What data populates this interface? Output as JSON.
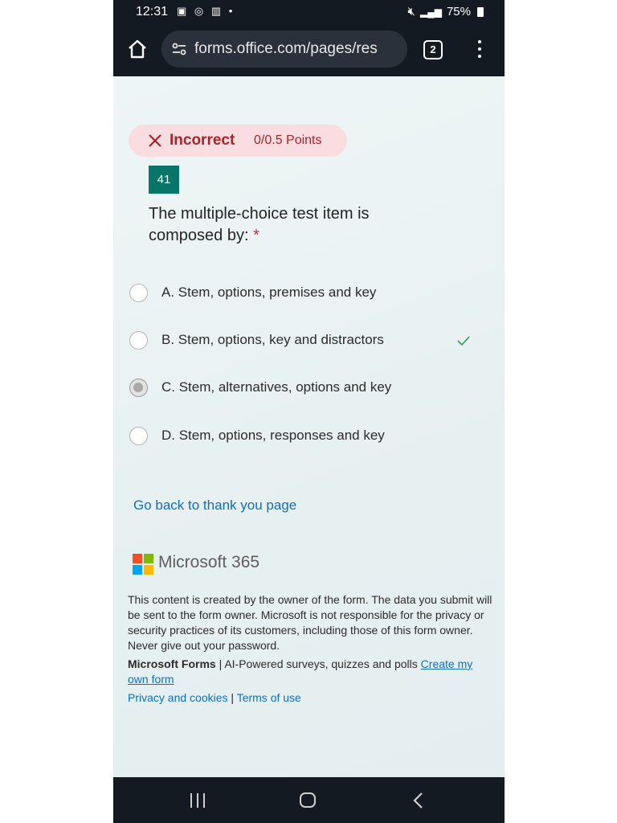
{
  "status_bar": {
    "time": "12:31",
    "left_icons": [
      "gallery-icon",
      "whatsapp-icon",
      "book-icon",
      "dot-icon"
    ],
    "battery": "75%"
  },
  "browser": {
    "url": "forms.office.com/pages/res",
    "tab_count": "2"
  },
  "result": {
    "status": "Incorrect",
    "points": "0/0.5 Points",
    "color": "#a4262c"
  },
  "question": {
    "number": "41",
    "text": "The multiple-choice test item is composed by:",
    "required_mark": "*",
    "options": [
      {
        "label": "A. Stem, options, premises and key",
        "selected": false,
        "correct": false
      },
      {
        "label": "B. Stem, options, key and distractors",
        "selected": false,
        "correct": true
      },
      {
        "label": "C. Stem, alternatives, options and key",
        "selected": true,
        "correct": false
      },
      {
        "label": "D. Stem, options, responses and key",
        "selected": false,
        "correct": false
      }
    ]
  },
  "back_link": "Go back to thank you page",
  "footer": {
    "brand": "Microsoft 365",
    "disclaimer": "This content is created by the owner of the form. The data you submit will be sent to the form owner. Microsoft is not responsible for the privacy or security practices of its customers, including those of this form owner. Never give out your password.",
    "forms_name": "Microsoft Forms",
    "forms_tagline": " | AI-Powered surveys, quizzes and polls ",
    "create_link": "Create my own form",
    "privacy_link": "Privacy and cookies",
    "separator": " | ",
    "terms_link": "Terms of use"
  },
  "colors": {
    "accent": "#077568",
    "link": "#106ebe",
    "incorrect_bg": "#f9dde1",
    "correct_check": "#2e9e4f"
  }
}
